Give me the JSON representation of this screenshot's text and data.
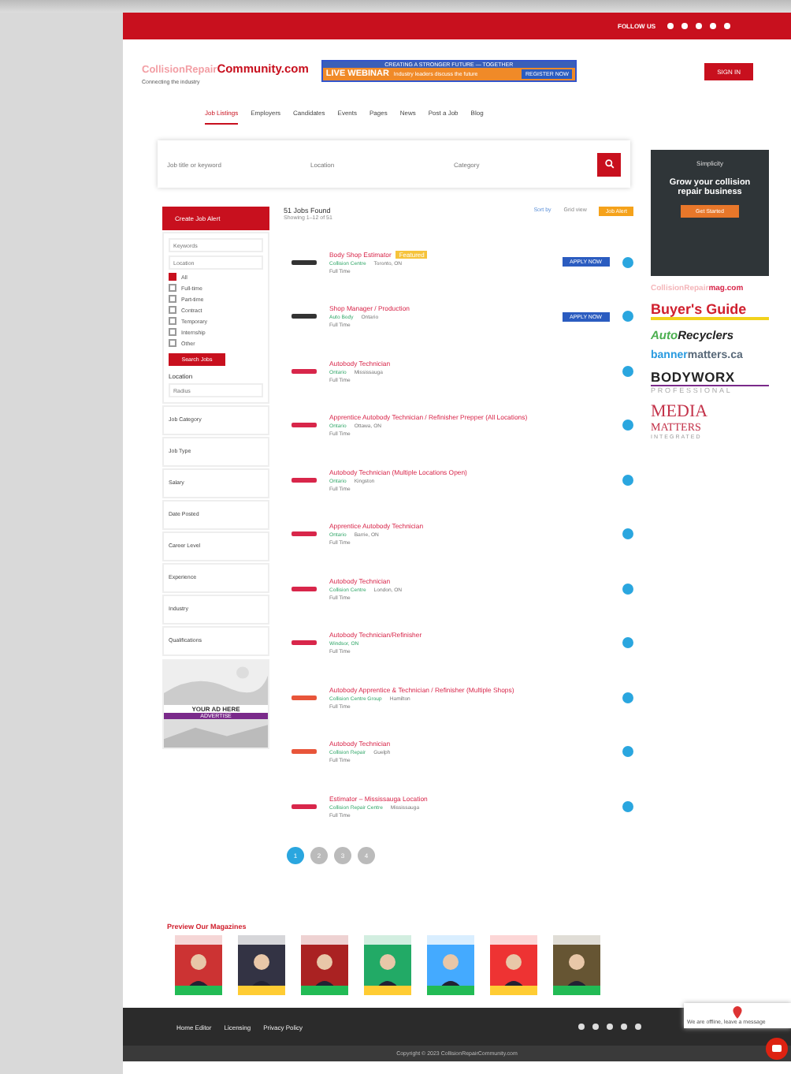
{
  "top_bar": {
    "follow_label": "FOLLOW US"
  },
  "header": {
    "logo_light": "CollisionRepair",
    "logo_bold": "Community.com",
    "tagline": "Connecting the industry",
    "ad": {
      "top": "CREATING A STRONGER FUTURE — TOGETHER",
      "main": "LIVE WEBINAR",
      "sub": "Industry leaders discuss the future",
      "cta": "REGISTER NOW"
    },
    "sign_in": "SIGN IN"
  },
  "nav": [
    {
      "label": "Job Listings",
      "selected": true
    },
    {
      "label": "Employers",
      "selected": false
    },
    {
      "label": "Candidates",
      "selected": false
    },
    {
      "label": "Events",
      "selected": false
    },
    {
      "label": "Pages",
      "selected": false
    },
    {
      "label": "News",
      "selected": false
    },
    {
      "label": "Post a Job",
      "selected": false
    },
    {
      "label": "Blog",
      "selected": false
    }
  ],
  "search": {
    "keyword_placeholder": "Job title or keyword",
    "location_placeholder": "Location",
    "category_placeholder": "Category"
  },
  "sidebar": {
    "alert_button": "Create Job Alert",
    "keyword_placeholder": "Keywords",
    "location_placeholder": "Location",
    "filters": [
      {
        "label": "All",
        "checked": true
      },
      {
        "label": "Full-time",
        "checked": false
      },
      {
        "label": "Part-time",
        "checked": false
      },
      {
        "label": "Contract",
        "checked": false
      },
      {
        "label": "Temporary",
        "checked": false
      },
      {
        "label": "Internship",
        "checked": false
      },
      {
        "label": "Other",
        "checked": false
      }
    ],
    "apply_button": "Search Jobs",
    "location_title": "Location",
    "radius_placeholder": "Radius",
    "sections": [
      "Job Category",
      "Job Type",
      "Salary",
      "Date Posted",
      "Career Level",
      "Experience",
      "Industry",
      "Qualifications"
    ],
    "ad_text": "YOUR AD HERE",
    "ad_cta": "ADVERTISE"
  },
  "results": {
    "count": "51 Jobs Found",
    "subtitle": "Showing 1–12 of 51",
    "sort": "Sort by",
    "view": "Grid view",
    "alert": "Job Alert"
  },
  "jobs": [
    {
      "title": "Body Shop Estimator",
      "badge": "Featured",
      "company": "Collision Centre",
      "location": "Toronto, ON",
      "type": "Full Time",
      "apply": "APPLY NOW",
      "color": "#333333"
    },
    {
      "title": "Shop Manager / Production",
      "company": "Auto Body",
      "location": "Ontario",
      "type": "Full Time",
      "apply": "APPLY NOW",
      "color": "#333333"
    },
    {
      "title": "Autobody Technician",
      "company": "Ontario",
      "location": "Mississauga",
      "type": "Full Time",
      "color": "#d8264a"
    },
    {
      "title": "Apprentice Autobody Technician / Refinisher Prepper (All Locations)",
      "company": "Ontario",
      "location": "Ottawa, ON",
      "type": "Full Time",
      "color": "#d8264a"
    },
    {
      "title": "Autobody Technician (Multiple Locations Open)",
      "company": "Ontario",
      "location": "Kingston",
      "type": "Full Time",
      "color": "#d8264a"
    },
    {
      "title": "Apprentice Autobody Technician",
      "company": "Ontario",
      "location": "Barrie, ON",
      "type": "Full Time",
      "color": "#d8264a"
    },
    {
      "title": "Autobody Technician",
      "company": "Collision Centre",
      "location": "London, ON",
      "type": "Full Time",
      "color": "#d8264a"
    },
    {
      "title": "Autobody Technician/Refinisher",
      "company": "Windsor, ON",
      "type": "Full Time",
      "color": "#d8264a"
    },
    {
      "title": "Autobody Apprentice & Technician / Refinisher (Multiple Shops)",
      "company": "Collision Centre Group",
      "location": "Hamilton",
      "type": "Full Time",
      "color": "#e8553a"
    },
    {
      "title": "Autobody Technician",
      "company": "Collision Repair",
      "location": "Guelph",
      "type": "Full Time",
      "color": "#e8553a"
    },
    {
      "title": "Estimator – Mississauga Location",
      "company": "Collision Repair Centre",
      "location": "Mississauga",
      "type": "Full Time",
      "color": "#d8264a"
    }
  ],
  "pagination": [
    {
      "label": "1",
      "selected": true
    },
    {
      "label": "2",
      "selected": false
    },
    {
      "label": "3",
      "selected": false
    },
    {
      "label": "4",
      "selected": false
    }
  ],
  "right_ads": {
    "brand": "Simplicity",
    "text": "Grow your collision repair business",
    "cta": "Get Started",
    "logos": [
      {
        "kind": "mag",
        "light": "CollisionRepair",
        "bold": "mag.com"
      },
      {
        "kind": "guide",
        "text": "Buyer's Guide"
      },
      {
        "kind": "recyclers",
        "light": "Auto",
        "bold": "Recyclers"
      },
      {
        "kind": "banner",
        "light": "banner",
        "bold": "matters.ca"
      },
      {
        "kind": "bodyworx",
        "text": "BODYWORX",
        "sub": "PROFESSIONAL"
      },
      {
        "kind": "media",
        "text": "MEDIA",
        "sub": "MATTERS",
        "tag": "INTEGRATED"
      }
    ]
  },
  "magazines": {
    "title": "Preview Our Magazines"
  },
  "chat": {
    "text": "We are offline, leave a message"
  },
  "footer": {
    "links": [
      "Home Editor",
      "Licensing",
      "Privacy Policy"
    ],
    "copyright": "Copyright © 2023 CollisionRepairCommunity.com"
  }
}
